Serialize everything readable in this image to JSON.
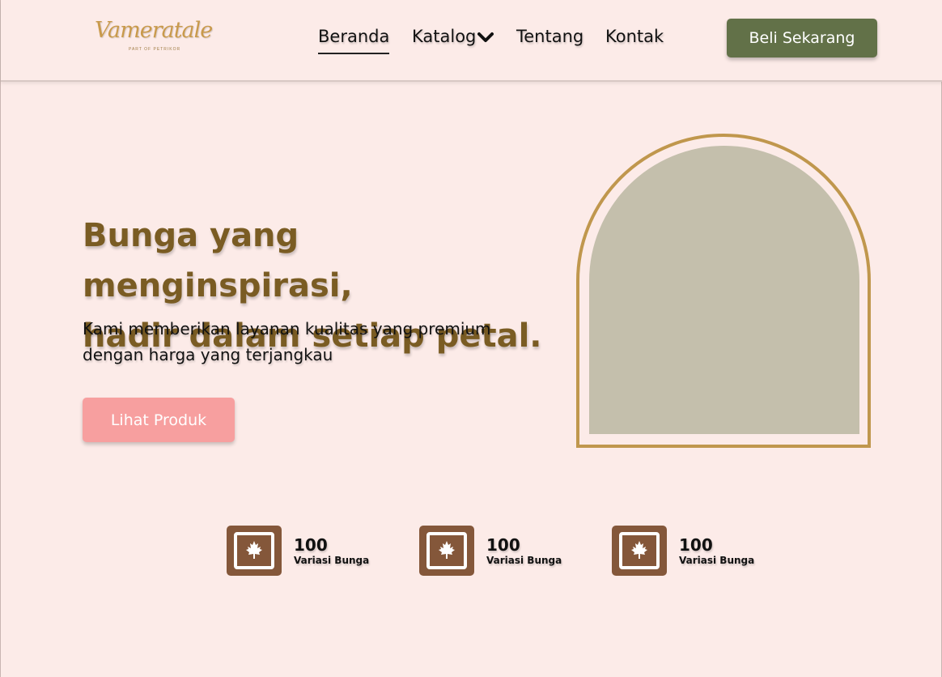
{
  "brand": {
    "logo_text": "Vameratale",
    "logo_subtext": "PART OF PETRIKOR"
  },
  "nav": {
    "items": [
      {
        "label": "Beranda",
        "active": true
      },
      {
        "label": "Katalog",
        "has_dropdown": true
      },
      {
        "label": "Tentang"
      },
      {
        "label": "Kontak"
      }
    ],
    "cta_label": "Beli Sekarang"
  },
  "hero": {
    "title_line1": "Bunga yang menginspirasi,",
    "title_line2": "hadir dalam setiap petal.",
    "subtitle_line1": "Kami memberikan layanan kualitas yang premium",
    "subtitle_line2": "dengan harga yang terjangkau",
    "cta_label": "Lihat Produk"
  },
  "stats": [
    {
      "value": "100",
      "label": "Variasi Bunga",
      "icon": "maple-leaf-icon"
    },
    {
      "value": "100",
      "label": "Variasi Bunga",
      "icon": "maple-leaf-icon"
    },
    {
      "value": "100",
      "label": "Variasi Bunga",
      "icon": "maple-leaf-icon"
    }
  ],
  "colors": {
    "background": "#fcebe8",
    "primary_button": "#627148",
    "secondary_button": "#f79f9f",
    "title_text": "#7a5c23",
    "arch_border": "#c0974d",
    "image_placeholder": "#c4bfac",
    "stat_icon_bg": "#84573a"
  }
}
